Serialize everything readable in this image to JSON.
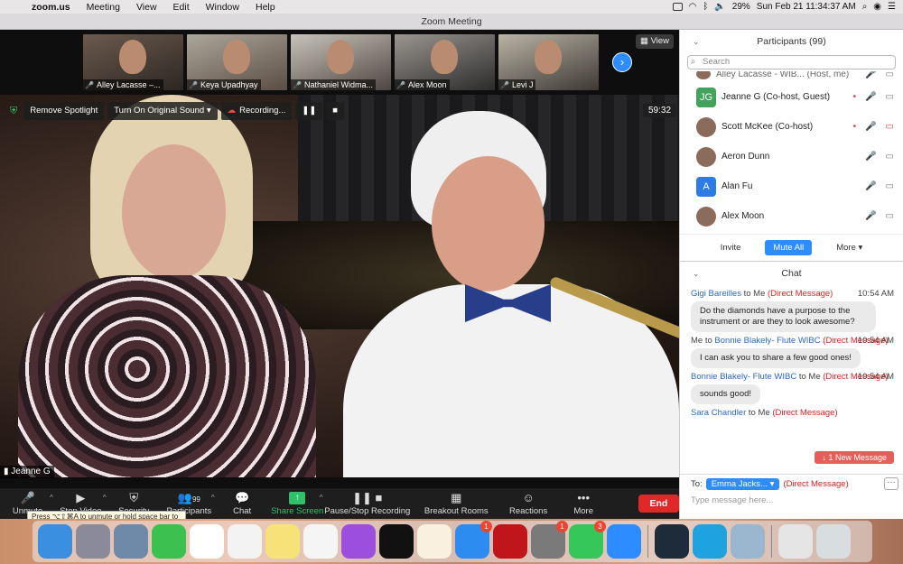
{
  "menubar": {
    "app": "zoom.us",
    "items": [
      "Meeting",
      "View",
      "Edit",
      "Window",
      "Help"
    ],
    "battery": "29%",
    "clock": "Sun Feb 21  11:34:37 AM"
  },
  "window": {
    "title": "Zoom Meeting"
  },
  "gallery": {
    "view_label": "View",
    "thumbs": [
      {
        "name": "Alley Lacasse –..."
      },
      {
        "name": "Keya Upadhyay"
      },
      {
        "name": "Nathaniel Widma..."
      },
      {
        "name": "Alex Moon"
      },
      {
        "name": "Levi J"
      }
    ]
  },
  "overlay": {
    "remove_spotlight": "Remove Spotlight",
    "original_sound": "Turn On Original Sound",
    "recording": "Recording...",
    "timer": "59:32"
  },
  "speaker": {
    "name": "Jeanne G"
  },
  "toolbar": {
    "unmute": "Unmute",
    "stop_video": "Stop Video",
    "security": "Security",
    "participants": "Participants",
    "participants_count": "99",
    "chat": "Chat",
    "share": "Share Screen",
    "recording": "Pause/Stop Recording",
    "breakout": "Breakout Rooms",
    "reactions": "Reactions",
    "more": "More",
    "end": "End",
    "tooltip": "Press ⌥⇧⌘A to unmute or hold space bar to temporarily unmute."
  },
  "participants": {
    "header": "Participants (99)",
    "search_placeholder": "Search",
    "rows": [
      {
        "name": "Alley Lacasse - WIB...  (Host, me)",
        "initials": ""
      },
      {
        "name": "Jeanne G (Co-host, Guest)",
        "initials": "JG"
      },
      {
        "name": "Scott McKee (Co-host)",
        "initials": ""
      },
      {
        "name": "Aeron Dunn",
        "initials": ""
      },
      {
        "name": "Alan Fu",
        "initials": "A"
      },
      {
        "name": "Alex Moon",
        "initials": ""
      }
    ],
    "invite": "Invite",
    "mute_all": "Mute All",
    "more": "More"
  },
  "chat": {
    "header": "Chat",
    "messages": [
      {
        "from": "Gigi Bareilles",
        "to": "to Me",
        "dm": "(Direct Message)",
        "time": "10:54 AM",
        "text": "Do the diamonds have a purpose to the instrument or are they to look awesome?"
      },
      {
        "from": "Me",
        "to": "to",
        "recipient": "Bonnie Blakely- Flute WIBC",
        "dm": "(Direct Message)",
        "time": "10:54 AM",
        "text": "I can ask you to share a few good ones!"
      },
      {
        "from": "Bonnie Blakely- Flute WIBC",
        "to": "to Me",
        "dm": "(Direct Message)",
        "time": "10:54 AM",
        "text": "sounds good!"
      },
      {
        "from": "Sara Chandler",
        "to": "to Me",
        "dm": "(Direct Message)",
        "time": "",
        "text": ""
      }
    ],
    "new_message": "↓ 1 New Message",
    "to_label": "To:",
    "recipient": "Emma Jacks...",
    "recipient_dm": "(Direct Message)",
    "placeholder": "Type message here..."
  },
  "dock": {
    "apps": [
      {
        "name": "finder",
        "color": "#3b8fe0",
        "badge": ""
      },
      {
        "name": "launchpad",
        "color": "#8a8a9a",
        "badge": ""
      },
      {
        "name": "preview",
        "color": "#6f8aa8",
        "badge": ""
      },
      {
        "name": "facetime",
        "color": "#3cc150",
        "badge": ""
      },
      {
        "name": "chrome",
        "color": "#ffffff",
        "badge": ""
      },
      {
        "name": "photos",
        "color": "#f3f3f3",
        "badge": ""
      },
      {
        "name": "notes",
        "color": "#f7e27a",
        "badge": ""
      },
      {
        "name": "music",
        "color": "#f5f5f5",
        "badge": ""
      },
      {
        "name": "podcasts",
        "color": "#9b4fdc",
        "badge": ""
      },
      {
        "name": "tv",
        "color": "#111111",
        "badge": ""
      },
      {
        "name": "pages",
        "color": "#f9f0df",
        "badge": ""
      },
      {
        "name": "app-store",
        "color": "#2d8cf0",
        "badge": "1"
      },
      {
        "name": "acrobat",
        "color": "#c0151b",
        "badge": ""
      },
      {
        "name": "system-preferences",
        "color": "#7a7a7a",
        "badge": "1"
      },
      {
        "name": "messages",
        "color": "#35c759",
        "badge": "3"
      },
      {
        "name": "zoom",
        "color": "#2d8cff",
        "badge": ""
      },
      {
        "name": "quicktime",
        "color": "#1e2b3a",
        "badge": ""
      },
      {
        "name": "skype",
        "color": "#1ea3e0",
        "badge": ""
      },
      {
        "name": "image-capture",
        "color": "#9bb7d0",
        "badge": ""
      },
      {
        "name": "music-folder",
        "color": "#e5e5e5",
        "badge": ""
      },
      {
        "name": "trash",
        "color": "#d8dde0",
        "badge": ""
      }
    ]
  }
}
